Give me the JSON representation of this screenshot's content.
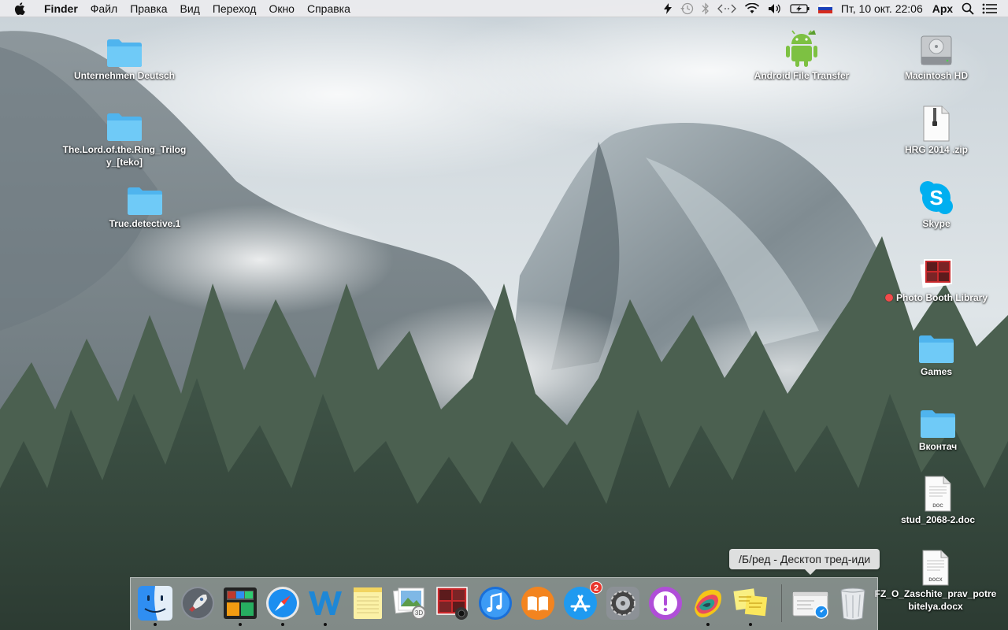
{
  "menubar": {
    "app_name": "Finder",
    "items": [
      "Файл",
      "Правка",
      "Вид",
      "Переход",
      "Окно",
      "Справка"
    ],
    "clock": "Пт, 10 окт.  22:06",
    "user": "Арх",
    "status_icons": [
      "flash-icon",
      "time-machine-icon",
      "bluetooth-icon",
      "airdrop-icon",
      "wifi-icon",
      "volume-icon",
      "battery-charging-icon",
      "russian-flag-icon"
    ]
  },
  "desktop": {
    "left_icons": [
      {
        "label": "Unternehmen Deutsch",
        "type": "folder"
      },
      {
        "label": "The.Lord.of.the.Ring_Trilogy_[teko]",
        "type": "folder"
      },
      {
        "label": "True.detective.1",
        "type": "folder"
      }
    ],
    "right_icons": [
      {
        "label": "Android File Transfer",
        "type": "android-app"
      },
      {
        "label": "Macintosh HD",
        "type": "hard-drive"
      },
      {
        "label": "HRG 2014 .zip",
        "type": "zip-file"
      },
      {
        "label": "Skype",
        "type": "skype-app"
      },
      {
        "label": "Photo Booth Library",
        "type": "photo-booth-library"
      },
      {
        "label": "Games",
        "type": "folder"
      },
      {
        "label": "Вконтач",
        "type": "folder"
      },
      {
        "label": "stud_2068-2.doc",
        "type": "doc-file",
        "doc_tag": "DOC"
      },
      {
        "label": "FZ_O_Zaschite_prav_potrebitelya.docx",
        "type": "docx-file",
        "doc_tag": "DOCX"
      }
    ],
    "zip_tag": "ZIP"
  },
  "dock": {
    "items": [
      {
        "name": "finder",
        "running": true
      },
      {
        "name": "launchpad",
        "running": false
      },
      {
        "name": "mission-control",
        "running": true
      },
      {
        "name": "safari",
        "running": true
      },
      {
        "name": "word",
        "running": true
      },
      {
        "name": "notes",
        "running": false
      },
      {
        "name": "preview",
        "running": false
      },
      {
        "name": "photo-booth",
        "running": false
      },
      {
        "name": "itunes",
        "running": false
      },
      {
        "name": "ibooks",
        "running": false
      },
      {
        "name": "app-store",
        "running": false,
        "badge": "2"
      },
      {
        "name": "system-preferences",
        "running": false
      },
      {
        "name": "feedback-assistant",
        "running": false
      },
      {
        "name": "colorful-app",
        "running": true
      },
      {
        "name": "stickies",
        "running": true
      }
    ],
    "tooltip": "/Б/ред - Десктоп тред-иди",
    "colors": {
      "folder": "#5ac8fa",
      "accent": "#1a8cf0"
    }
  }
}
